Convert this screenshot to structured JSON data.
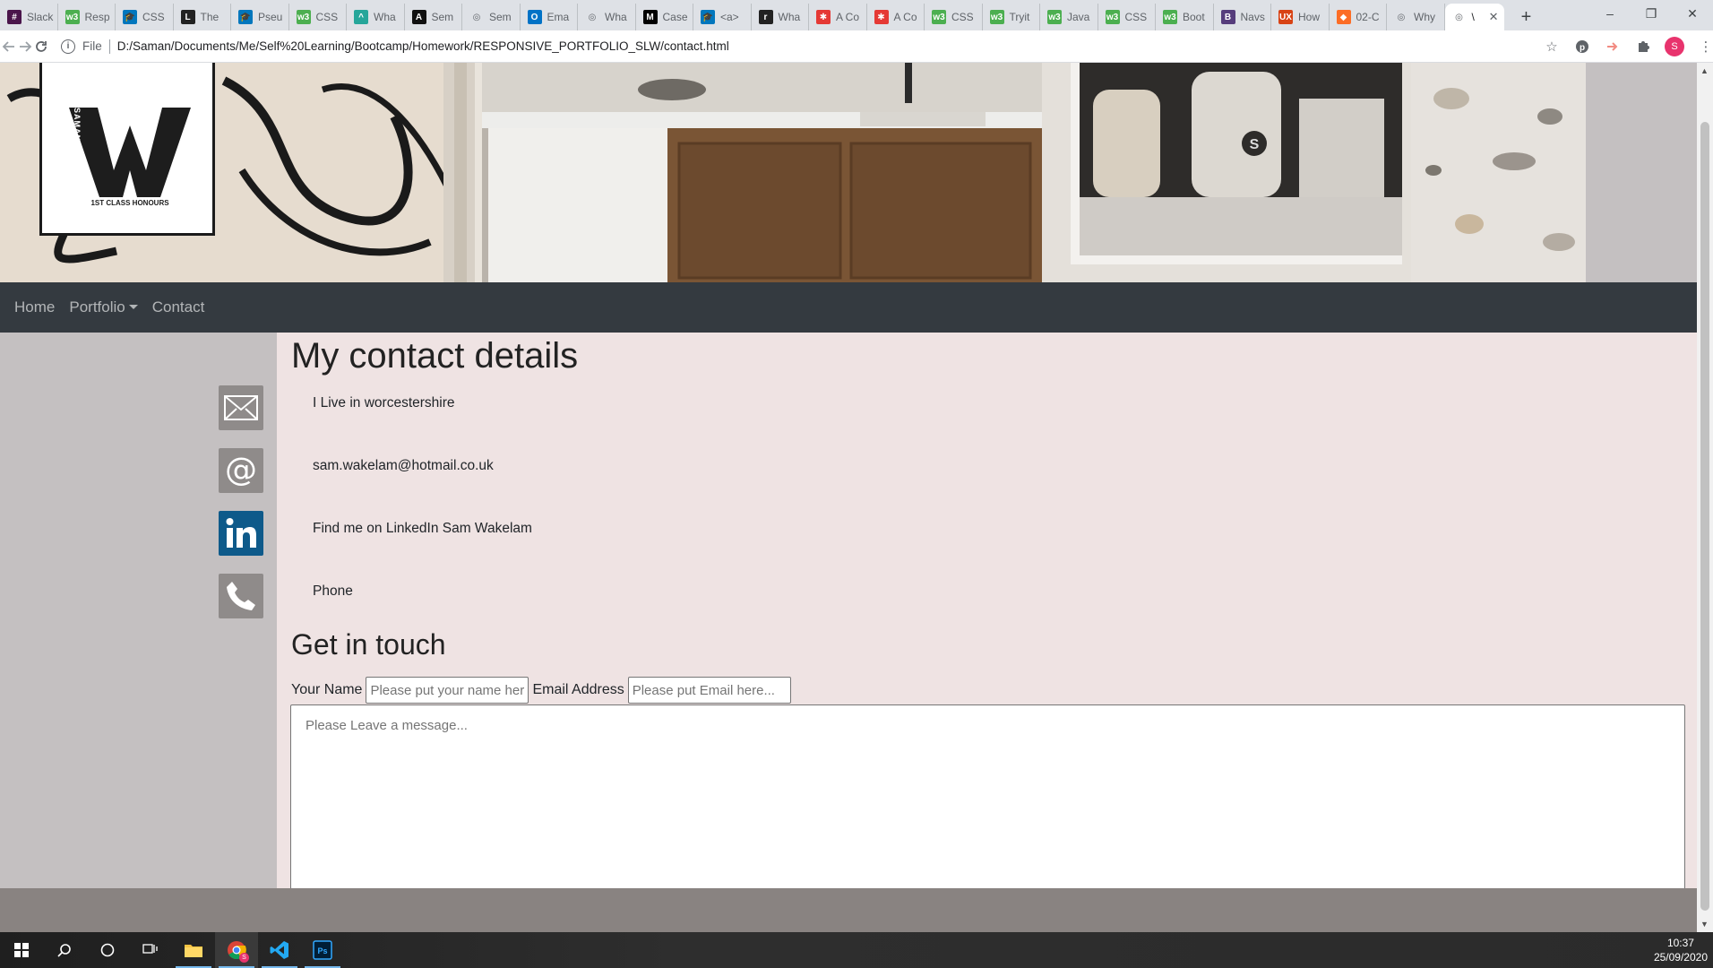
{
  "browser": {
    "tabs": [
      {
        "label": "Slack",
        "icon": "slack-icon",
        "color": "#4a154b"
      },
      {
        "label": "Resp",
        "icon": "w3schools-icon",
        "color": "#4caf50"
      },
      {
        "label": "CSS",
        "icon": "graduation-icon",
        "color": "#0277bd"
      },
      {
        "label": "The",
        "icon": "letter-l-icon",
        "color": "#222222"
      },
      {
        "label": "Pseu",
        "icon": "graduation-icon",
        "color": "#0277bd"
      },
      {
        "label": "CSS",
        "icon": "w3schools-icon",
        "color": "#4caf50"
      },
      {
        "label": "Wha",
        "icon": "hat-icon",
        "color": "#26a69a"
      },
      {
        "label": "Sem",
        "icon": "letter-a-icon",
        "color": "#111111"
      },
      {
        "label": "Sem",
        "icon": "globe-icon",
        "color": "#5f6368"
      },
      {
        "label": "Ema",
        "icon": "outlook-icon",
        "color": "#0072c6"
      },
      {
        "label": "Wha",
        "icon": "globe-icon",
        "color": "#5f6368"
      },
      {
        "label": "Case",
        "icon": "medium-icon",
        "color": "#000000"
      },
      {
        "label": "<a>",
        "icon": "graduation-icon",
        "color": "#0277bd"
      },
      {
        "label": "Wha",
        "icon": "letter-r-icon",
        "color": "#222222"
      },
      {
        "label": "A Co",
        "icon": "asterisk-icon",
        "color": "#e53935"
      },
      {
        "label": "A Co",
        "icon": "asterisk-icon",
        "color": "#e53935"
      },
      {
        "label": "CSS",
        "icon": "w3schools-icon",
        "color": "#4caf50"
      },
      {
        "label": "Tryit",
        "icon": "w3schools-icon",
        "color": "#4caf50"
      },
      {
        "label": "Java",
        "icon": "w3schools-icon",
        "color": "#4caf50"
      },
      {
        "label": "CSS",
        "icon": "w3schools-icon",
        "color": "#4caf50"
      },
      {
        "label": "Boot",
        "icon": "w3schools-icon",
        "color": "#4caf50"
      },
      {
        "label": "Navs",
        "icon": "letter-b-icon",
        "color": "#563d7c"
      },
      {
        "label": "How",
        "icon": "ux-icon",
        "color": "#d84315"
      },
      {
        "label": "02-C",
        "icon": "gitlab-icon",
        "color": "#fc6d26"
      },
      {
        "label": "Why",
        "icon": "globe-icon",
        "color": "#5f6368"
      }
    ],
    "active_tab": {
      "label": "\\",
      "icon": "globe-icon"
    },
    "new_tab": "+",
    "window_controls": {
      "minimize": "–",
      "restore": "❐",
      "close": "✕"
    },
    "address": {
      "scheme_label": "File",
      "url": "D:/Saman/Documents/Me/Self%20Learning/Bootcamp/Homework/RESPONSIVE_PORTFOLIO_SLW/contact.html"
    },
    "profile_initial": "S"
  },
  "site": {
    "logo": {
      "letter": "W",
      "vertical_text": "SAMANTHA",
      "caption": "1ST CLASS HONOURS"
    },
    "nav": {
      "home": "Home",
      "portfolio": "Portfolio",
      "contact": "Contact"
    },
    "contact": {
      "heading": "My contact details",
      "location": "I Live in worcestershire",
      "email": "sam.wakelam@hotmail.co.uk",
      "linkedin": "Find me on LinkedIn Sam Wakelam",
      "phone": "Phone"
    },
    "form": {
      "heading": "Get in touch",
      "name_label": "Your Name",
      "name_placeholder": "Please put your name here...",
      "email_label": "Email Address",
      "email_placeholder": "Please put Email here...",
      "message_placeholder": "Please Leave a message..."
    },
    "colors": {
      "nav_bg": "#343a40",
      "main_bg": "#efe3e3",
      "side_bg": "#c4c0c1",
      "footer_bg": "#898381",
      "linkedin": "#0e5a8a"
    }
  },
  "taskbar": {
    "clock_time": "10:37",
    "clock_date": "25/09/2020",
    "badge": "S"
  }
}
